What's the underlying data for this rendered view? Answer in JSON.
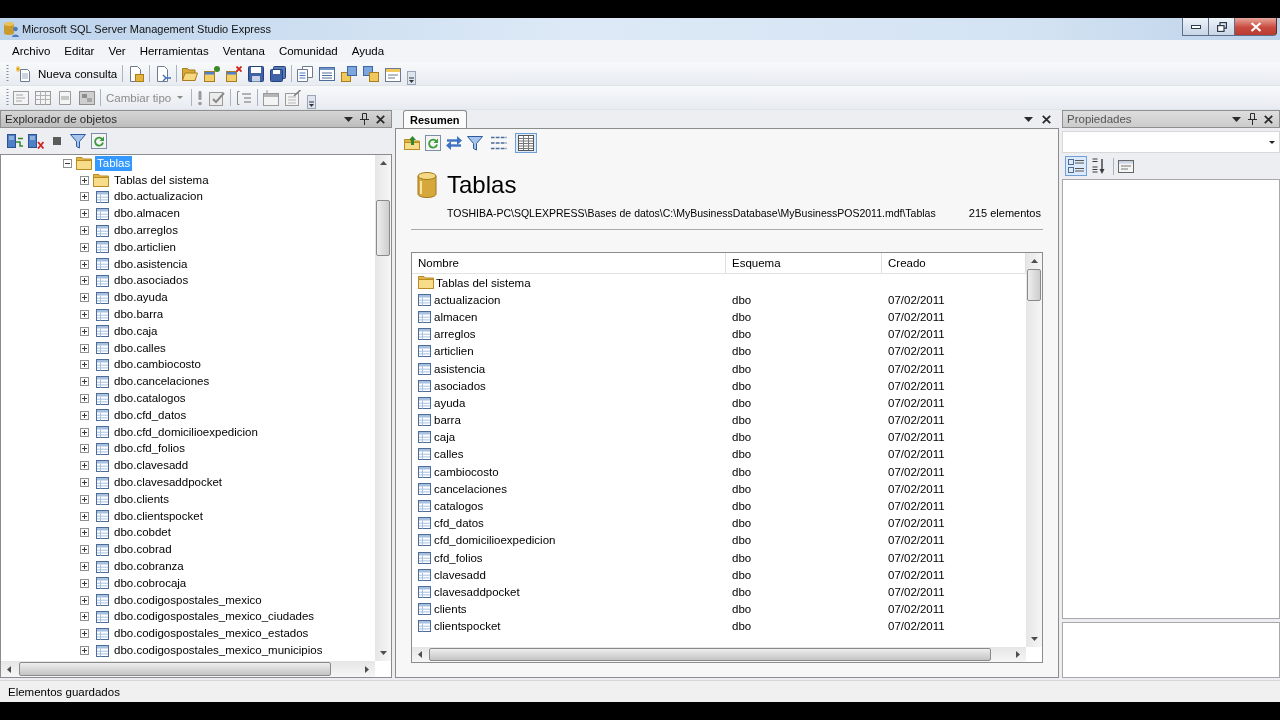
{
  "window": {
    "title": "Microsoft SQL Server Management Studio Express"
  },
  "menu": [
    "Archivo",
    "Editar",
    "Ver",
    "Herramientas",
    "Ventana",
    "Comunidad",
    "Ayuda"
  ],
  "toolbar": {
    "new_query": "Nueva consulta"
  },
  "toolbar_2": {
    "change_type": {
      "label": "Cambiar tipo",
      "disabled": true
    }
  },
  "object_explorer": {
    "title": "Explorador de objetos",
    "tree": [
      {
        "label": "Tablas",
        "kind": "folder",
        "expanded": true,
        "selected": true,
        "children": [
          {
            "label": "Tablas del sistema",
            "kind": "folder",
            "expanded": false,
            "selected": false
          },
          {
            "label": "dbo.actualizacion",
            "kind": "table",
            "expanded": false,
            "selected": false
          },
          {
            "label": "dbo.almacen",
            "kind": "table",
            "expanded": false,
            "selected": false
          },
          {
            "label": "dbo.arreglos",
            "kind": "table",
            "expanded": false,
            "selected": false
          },
          {
            "label": "dbo.articlien",
            "kind": "table",
            "expanded": false,
            "selected": false
          },
          {
            "label": "dbo.asistencia",
            "kind": "table",
            "expanded": false,
            "selected": false
          },
          {
            "label": "dbo.asociados",
            "kind": "table",
            "expanded": false,
            "selected": false
          },
          {
            "label": "dbo.ayuda",
            "kind": "table",
            "expanded": false,
            "selected": false
          },
          {
            "label": "dbo.barra",
            "kind": "table",
            "expanded": false,
            "selected": false
          },
          {
            "label": "dbo.caja",
            "kind": "table",
            "expanded": false,
            "selected": false
          },
          {
            "label": "dbo.calles",
            "kind": "table",
            "expanded": false,
            "selected": false
          },
          {
            "label": "dbo.cambiocosto",
            "kind": "table",
            "expanded": false,
            "selected": false
          },
          {
            "label": "dbo.cancelaciones",
            "kind": "table",
            "expanded": false,
            "selected": false
          },
          {
            "label": "dbo.catalogos",
            "kind": "table",
            "expanded": false,
            "selected": false
          },
          {
            "label": "dbo.cfd_datos",
            "kind": "table",
            "expanded": false,
            "selected": false
          },
          {
            "label": "dbo.cfd_domicilioexpedicion",
            "kind": "table",
            "expanded": false,
            "selected": false
          },
          {
            "label": "dbo.cfd_folios",
            "kind": "table",
            "expanded": false,
            "selected": false
          },
          {
            "label": "dbo.clavesadd",
            "kind": "table",
            "expanded": false,
            "selected": false
          },
          {
            "label": "dbo.clavesaddpocket",
            "kind": "table",
            "expanded": false,
            "selected": false
          },
          {
            "label": "dbo.clients",
            "kind": "table",
            "expanded": false,
            "selected": false
          },
          {
            "label": "dbo.clientspocket",
            "kind": "table",
            "expanded": false,
            "selected": false
          },
          {
            "label": "dbo.cobdet",
            "kind": "table",
            "expanded": false,
            "selected": false
          },
          {
            "label": "dbo.cobrad",
            "kind": "table",
            "expanded": false,
            "selected": false
          },
          {
            "label": "dbo.cobranza",
            "kind": "table",
            "expanded": false,
            "selected": false
          },
          {
            "label": "dbo.cobrocaja",
            "kind": "table",
            "expanded": false,
            "selected": false
          },
          {
            "label": "dbo.codigospostales_mexico",
            "kind": "table",
            "expanded": false,
            "selected": false
          },
          {
            "label": "dbo.codigospostales_mexico_ciudades",
            "kind": "table",
            "expanded": false,
            "selected": false
          },
          {
            "label": "dbo.codigospostales_mexico_estados",
            "kind": "table",
            "expanded": false,
            "selected": false
          },
          {
            "label": "dbo.codigospostales_mexico_municipios",
            "kind": "table",
            "expanded": false,
            "selected": false
          }
        ]
      }
    ]
  },
  "summary": {
    "tab": {
      "label": "Resumen",
      "selected": true
    },
    "view_modes": [
      {
        "kind": "list",
        "selected": false
      },
      {
        "kind": "details",
        "selected": true
      }
    ],
    "heading": "Tablas",
    "path": "TOSHIBA-PC\\SQLEXPRESS\\Bases de datos\\C:\\MyBusinessDatabase\\MyBusinessPOS2011.mdf\\Tablas",
    "count": "215 elementos",
    "list": {
      "columns": [
        "Nombre",
        "Esquema",
        "Creado"
      ],
      "rows": [
        {
          "kind": "folder",
          "name": "Tablas del sistema",
          "selected": false
        },
        {
          "kind": "table",
          "name": "actualizacion",
          "schema": "dbo",
          "created": "07/02/2011",
          "selected": false
        },
        {
          "kind": "table",
          "name": "almacen",
          "schema": "dbo",
          "created": "07/02/2011",
          "selected": false
        },
        {
          "kind": "table",
          "name": "arreglos",
          "schema": "dbo",
          "created": "07/02/2011",
          "selected": false
        },
        {
          "kind": "table",
          "name": "articlien",
          "schema": "dbo",
          "created": "07/02/2011",
          "selected": false
        },
        {
          "kind": "table",
          "name": "asistencia",
          "schema": "dbo",
          "created": "07/02/2011",
          "selected": false
        },
        {
          "kind": "table",
          "name": "asociados",
          "schema": "dbo",
          "created": "07/02/2011",
          "selected": false
        },
        {
          "kind": "table",
          "name": "ayuda",
          "schema": "dbo",
          "created": "07/02/2011",
          "selected": false
        },
        {
          "kind": "table",
          "name": "barra",
          "schema": "dbo",
          "created": "07/02/2011",
          "selected": false
        },
        {
          "kind": "table",
          "name": "caja",
          "schema": "dbo",
          "created": "07/02/2011",
          "selected": false
        },
        {
          "kind": "table",
          "name": "calles",
          "schema": "dbo",
          "created": "07/02/2011",
          "selected": false
        },
        {
          "kind": "table",
          "name": "cambiocosto",
          "schema": "dbo",
          "created": "07/02/2011",
          "selected": false
        },
        {
          "kind": "table",
          "name": "cancelaciones",
          "schema": "dbo",
          "created": "07/02/2011",
          "selected": false
        },
        {
          "kind": "table",
          "name": "catalogos",
          "schema": "dbo",
          "created": "07/02/2011",
          "selected": false
        },
        {
          "kind": "table",
          "name": "cfd_datos",
          "schema": "dbo",
          "created": "07/02/2011",
          "selected": false
        },
        {
          "kind": "table",
          "name": "cfd_domicilioexpedicion",
          "schema": "dbo",
          "created": "07/02/2011",
          "selected": false
        },
        {
          "kind": "table",
          "name": "cfd_folios",
          "schema": "dbo",
          "created": "07/02/2011",
          "selected": false
        },
        {
          "kind": "table",
          "name": "clavesadd",
          "schema": "dbo",
          "created": "07/02/2011",
          "selected": false
        },
        {
          "kind": "table",
          "name": "clavesaddpocket",
          "schema": "dbo",
          "created": "07/02/2011",
          "selected": false
        },
        {
          "kind": "table",
          "name": "clients",
          "schema": "dbo",
          "created": "07/02/2011",
          "selected": false
        },
        {
          "kind": "table",
          "name": "clientspocket",
          "schema": "dbo",
          "created": "07/02/2011",
          "selected": false
        }
      ]
    }
  },
  "properties": {
    "title": "Propiedades",
    "sort_modes": [
      {
        "kind": "categorized",
        "selected": true
      },
      {
        "kind": "alphabetical",
        "selected": false
      }
    ]
  },
  "status_bar": {
    "text": "Elementos guardados"
  }
}
